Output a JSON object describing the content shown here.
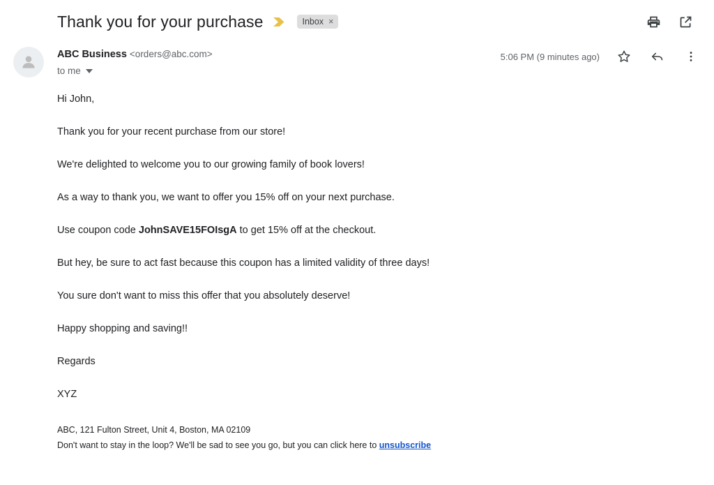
{
  "header": {
    "subject": "Thank you for your purchase",
    "important_marker_icon": "important-chevron-icon",
    "label_chip": {
      "text": "Inbox",
      "close_glyph": "×"
    },
    "actions": [
      {
        "name": "print-button",
        "icon": "print-icon"
      },
      {
        "name": "open-in-new-window-button",
        "icon": "open-in-new-icon"
      }
    ]
  },
  "message": {
    "avatar_icon": "person-avatar-icon",
    "sender_name": "ABC Business",
    "sender_email": "<orders@abc.com>",
    "recipient_label": "to me",
    "recipient_caret_icon": "chevron-down-icon",
    "timestamp": "5:06 PM (9 minutes ago)",
    "star_icon": "star-outline-icon",
    "reply_icon": "reply-arrow-icon",
    "more_icon": "more-vertical-icon",
    "body": {
      "greeting": "Hi John,",
      "p1": "Thank you for your recent purchase from our store!",
      "p2": "We're delighted to welcome you to our growing family of book lovers!",
      "p3": "As a way to thank you, we want to offer you 15% off on your next purchase.",
      "coupon_prefix": "Use coupon code ",
      "coupon_code": "JohnSAVE15FOIsgA",
      "coupon_suffix": " to get 15% off at the checkout.",
      "p5": "But hey, be sure to act fast because this coupon has a limited validity of three days!",
      "p6": "You sure don't want to miss this offer that you absolutely deserve!",
      "p7": "Happy shopping and saving!!",
      "signoff": "Regards",
      "signature": "XYZ"
    },
    "footer": {
      "address": "ABC, 121 Fulton Street, Unit 4, Boston, MA 02109",
      "unsubscribe_prefix": "Don't want to stay in the loop? We'll be sad to see you go, but you can click here to ",
      "unsubscribe_link": "unsubscribe"
    }
  },
  "colors": {
    "important_marker": "#e8c14a",
    "label_chip_bg": "#ddddde",
    "link": "#1155cc",
    "icon": "#5f6368",
    "text": "#202124",
    "muted_text": "#5f6368"
  }
}
